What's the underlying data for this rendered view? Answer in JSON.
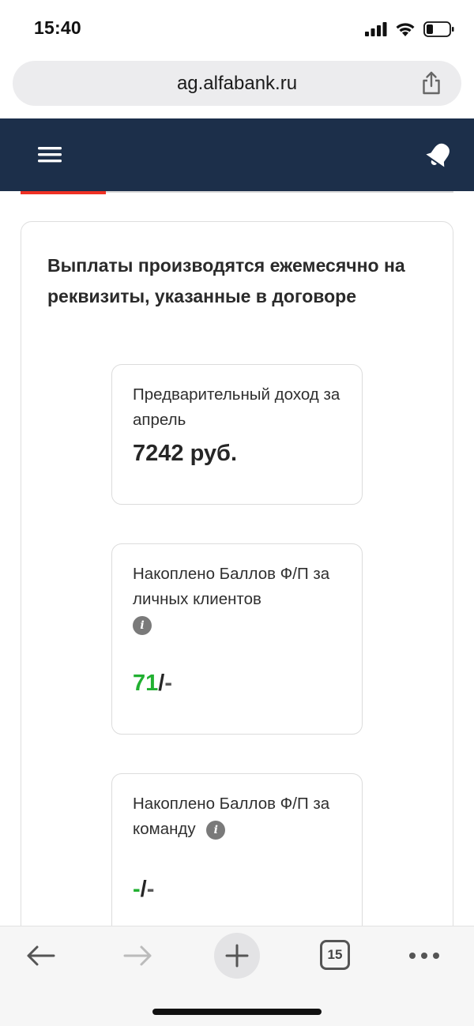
{
  "status_bar": {
    "time": "15:40"
  },
  "browser": {
    "url": "ag.alfabank.ru",
    "tab_count": "15"
  },
  "card": {
    "heading": "Выплаты производятся ежемесячно на реквизиты, указанные в договоре",
    "income": {
      "label": "Предварительный доход за апрель",
      "value": "7242 руб."
    },
    "personal_points": {
      "label": "Накоплено Баллов Ф/П за личных клиентов",
      "value_main": "71",
      "value_sep": "/",
      "value_rest": "-"
    },
    "team_points": {
      "label": "Накоплено Баллов Ф/П за команду",
      "value_main": "-",
      "value_sep": "/",
      "value_rest": "-"
    }
  },
  "colors": {
    "header_bg": "#1c2f4a",
    "accent_red": "#ef3124",
    "points_green": "#21b031"
  }
}
